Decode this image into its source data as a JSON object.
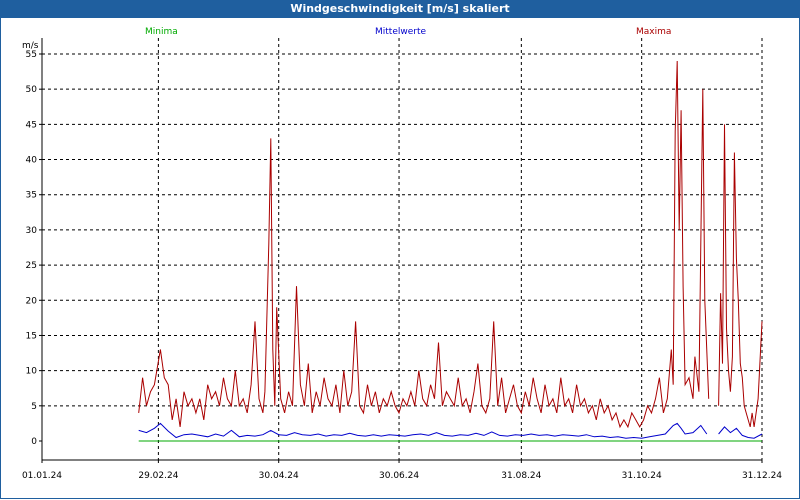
{
  "window": {
    "title": "Windgeschwindigkeit [m/s] skaliert"
  },
  "legend": {
    "minima": {
      "label": "Minima",
      "color": "#00aa00"
    },
    "mittel": {
      "label": "Mittelwerte",
      "color": "#0000cc"
    },
    "maxima": {
      "label": "Maxima",
      "color": "#aa0000"
    }
  },
  "chart_data": {
    "type": "line",
    "title": "Windgeschwindigkeit [m/s] skaliert",
    "ylabel": "m/s",
    "xlabel": "",
    "ylim": [
      0,
      55
    ],
    "yticks": [
      0,
      5,
      10,
      15,
      20,
      25,
      30,
      35,
      40,
      45,
      50,
      55
    ],
    "xlim": [
      "2024-01-01",
      "2024-12-31"
    ],
    "xticks": [
      {
        "date": "2024-01-01",
        "label": "01.01.24"
      },
      {
        "date": "2024-02-29",
        "label": "29.02.24"
      },
      {
        "date": "2024-04-30",
        "label": "30.04.24"
      },
      {
        "date": "2024-06-30",
        "label": "30.06.24"
      },
      {
        "date": "2024-08-31",
        "label": "31.08.24"
      },
      {
        "date": "2024-10-31",
        "label": "31.10.24"
      },
      {
        "date": "2024-12-31",
        "label": "31.12.24"
      }
    ],
    "grid": true,
    "legend_position": "top",
    "series": [
      {
        "name": "Maxima",
        "color": "#aa0000",
        "points": [
          [
            "2024-02-19",
            4
          ],
          [
            "2024-02-21",
            9
          ],
          [
            "2024-02-23",
            5
          ],
          [
            "2024-02-25",
            7
          ],
          [
            "2024-02-27",
            8
          ],
          [
            "2024-03-01",
            13
          ],
          [
            "2024-03-03",
            9
          ],
          [
            "2024-03-05",
            8
          ],
          [
            "2024-03-07",
            3
          ],
          [
            "2024-03-09",
            6
          ],
          [
            "2024-03-11",
            2
          ],
          [
            "2024-03-13",
            7
          ],
          [
            "2024-03-15",
            5
          ],
          [
            "2024-03-17",
            6
          ],
          [
            "2024-03-19",
            4
          ],
          [
            "2024-03-21",
            6
          ],
          [
            "2024-03-23",
            3
          ],
          [
            "2024-03-25",
            8
          ],
          [
            "2024-03-27",
            6
          ],
          [
            "2024-03-29",
            7
          ],
          [
            "2024-03-31",
            5
          ],
          [
            "2024-04-02",
            9
          ],
          [
            "2024-04-04",
            6
          ],
          [
            "2024-04-06",
            5
          ],
          [
            "2024-04-08",
            10
          ],
          [
            "2024-04-10",
            5
          ],
          [
            "2024-04-12",
            6
          ],
          [
            "2024-04-14",
            4
          ],
          [
            "2024-04-16",
            8
          ],
          [
            "2024-04-18",
            17
          ],
          [
            "2024-04-20",
            6
          ],
          [
            "2024-04-22",
            4
          ],
          [
            "2024-04-23",
            7
          ],
          [
            "2024-04-25",
            28
          ],
          [
            "2024-04-26",
            43
          ],
          [
            "2024-04-27",
            13
          ],
          [
            "2024-04-28",
            5
          ],
          [
            "2024-04-29",
            19
          ],
          [
            "2024-05-01",
            6
          ],
          [
            "2024-05-03",
            4
          ],
          [
            "2024-05-05",
            7
          ],
          [
            "2024-05-07",
            5
          ],
          [
            "2024-05-09",
            22
          ],
          [
            "2024-05-11",
            8
          ],
          [
            "2024-05-13",
            5
          ],
          [
            "2024-05-15",
            11
          ],
          [
            "2024-05-17",
            4
          ],
          [
            "2024-05-19",
            7
          ],
          [
            "2024-05-21",
            5
          ],
          [
            "2024-05-23",
            9
          ],
          [
            "2024-05-25",
            6
          ],
          [
            "2024-05-27",
            5
          ],
          [
            "2024-05-29",
            8
          ],
          [
            "2024-05-31",
            4
          ],
          [
            "2024-06-02",
            10
          ],
          [
            "2024-06-04",
            5
          ],
          [
            "2024-06-06",
            7
          ],
          [
            "2024-06-08",
            17
          ],
          [
            "2024-06-10",
            5
          ],
          [
            "2024-06-12",
            4
          ],
          [
            "2024-06-14",
            8
          ],
          [
            "2024-06-16",
            5
          ],
          [
            "2024-06-18",
            7
          ],
          [
            "2024-06-20",
            4
          ],
          [
            "2024-06-22",
            6
          ],
          [
            "2024-06-24",
            5
          ],
          [
            "2024-06-26",
            7
          ],
          [
            "2024-06-28",
            5
          ],
          [
            "2024-06-30",
            4
          ],
          [
            "2024-07-02",
            6
          ],
          [
            "2024-07-04",
            5
          ],
          [
            "2024-07-06",
            7
          ],
          [
            "2024-07-08",
            5
          ],
          [
            "2024-07-10",
            10
          ],
          [
            "2024-07-12",
            6
          ],
          [
            "2024-07-14",
            5
          ],
          [
            "2024-07-16",
            8
          ],
          [
            "2024-07-18",
            6
          ],
          [
            "2024-07-20",
            14
          ],
          [
            "2024-07-22",
            5
          ],
          [
            "2024-07-24",
            7
          ],
          [
            "2024-07-26",
            6
          ],
          [
            "2024-07-28",
            5
          ],
          [
            "2024-07-30",
            9
          ],
          [
            "2024-08-01",
            5
          ],
          [
            "2024-08-03",
            6
          ],
          [
            "2024-08-05",
            4
          ],
          [
            "2024-08-07",
            7
          ],
          [
            "2024-08-09",
            11
          ],
          [
            "2024-08-11",
            5
          ],
          [
            "2024-08-13",
            4
          ],
          [
            "2024-08-15",
            6
          ],
          [
            "2024-08-17",
            17
          ],
          [
            "2024-08-19",
            5
          ],
          [
            "2024-08-21",
            9
          ],
          [
            "2024-08-23",
            4
          ],
          [
            "2024-08-25",
            6
          ],
          [
            "2024-08-27",
            8
          ],
          [
            "2024-08-29",
            5
          ],
          [
            "2024-08-31",
            4
          ],
          [
            "2024-09-02",
            7
          ],
          [
            "2024-09-04",
            5
          ],
          [
            "2024-09-06",
            9
          ],
          [
            "2024-09-08",
            6
          ],
          [
            "2024-09-10",
            4
          ],
          [
            "2024-09-12",
            8
          ],
          [
            "2024-09-14",
            5
          ],
          [
            "2024-09-16",
            6
          ],
          [
            "2024-09-18",
            4
          ],
          [
            "2024-09-20",
            9
          ],
          [
            "2024-09-22",
            5
          ],
          [
            "2024-09-24",
            6
          ],
          [
            "2024-09-26",
            4
          ],
          [
            "2024-09-28",
            8
          ],
          [
            "2024-09-30",
            5
          ],
          [
            "2024-10-02",
            6
          ],
          [
            "2024-10-04",
            4
          ],
          [
            "2024-10-06",
            5
          ],
          [
            "2024-10-08",
            3
          ],
          [
            "2024-10-10",
            6
          ],
          [
            "2024-10-12",
            4
          ],
          [
            "2024-10-14",
            5
          ],
          [
            "2024-10-16",
            3
          ],
          [
            "2024-10-18",
            4
          ],
          [
            "2024-10-20",
            2
          ],
          [
            "2024-10-22",
            3
          ],
          [
            "2024-10-24",
            2
          ],
          [
            "2024-10-26",
            4
          ],
          [
            "2024-10-28",
            3
          ],
          [
            "2024-10-30",
            2
          ],
          [
            "2024-11-01",
            3
          ],
          [
            "2024-11-03",
            5
          ],
          [
            "2024-11-05",
            4
          ],
          [
            "2024-11-07",
            6
          ],
          [
            "2024-11-09",
            9
          ],
          [
            "2024-11-11",
            4
          ],
          [
            "2024-11-13",
            6
          ],
          [
            "2024-11-15",
            13
          ],
          [
            "2024-11-16",
            8
          ],
          [
            "2024-11-17",
            44
          ],
          [
            "2024-11-18",
            54
          ],
          [
            "2024-11-19",
            30
          ],
          [
            "2024-11-20",
            47
          ],
          [
            "2024-11-21",
            22
          ],
          [
            "2024-11-22",
            8
          ],
          [
            "2024-11-24",
            9
          ],
          [
            "2024-11-26",
            6
          ],
          [
            "2024-11-27",
            12
          ],
          [
            "2024-11-29",
            7
          ],
          [
            "2024-12-01",
            50
          ],
          [
            "2024-12-02",
            20
          ],
          [
            "2024-12-04",
            6
          ],
          [
            "2024-12-06",
            null
          ],
          [
            "2024-12-09",
            5
          ],
          [
            "2024-12-10",
            21
          ],
          [
            "2024-12-11",
            11
          ],
          [
            "2024-12-12",
            45
          ],
          [
            "2024-12-13",
            16
          ],
          [
            "2024-12-14",
            10
          ],
          [
            "2024-12-15",
            7
          ],
          [
            "2024-12-16",
            12
          ],
          [
            "2024-12-17",
            41
          ],
          [
            "2024-12-18",
            26
          ],
          [
            "2024-12-19",
            20
          ],
          [
            "2024-12-20",
            11
          ],
          [
            "2024-12-21",
            9
          ],
          [
            "2024-12-22",
            5
          ],
          [
            "2024-12-23",
            4
          ],
          [
            "2024-12-24",
            3
          ],
          [
            "2024-12-25",
            2
          ],
          [
            "2024-12-26",
            4
          ],
          [
            "2024-12-27",
            2
          ],
          [
            "2024-12-29",
            6
          ],
          [
            "2024-12-31",
            17
          ]
        ]
      },
      {
        "name": "Mittelwerte",
        "color": "#0000cc",
        "points": [
          [
            "2024-02-19",
            1.5
          ],
          [
            "2024-02-23",
            1.2
          ],
          [
            "2024-02-27",
            1.8
          ],
          [
            "2024-03-01",
            2.5
          ],
          [
            "2024-03-05",
            1.4
          ],
          [
            "2024-03-09",
            0.5
          ],
          [
            "2024-03-13",
            0.9
          ],
          [
            "2024-03-17",
            1.0
          ],
          [
            "2024-03-21",
            0.8
          ],
          [
            "2024-03-25",
            0.6
          ],
          [
            "2024-03-29",
            1.0
          ],
          [
            "2024-04-02",
            0.7
          ],
          [
            "2024-04-06",
            1.5
          ],
          [
            "2024-04-10",
            0.6
          ],
          [
            "2024-04-14",
            0.8
          ],
          [
            "2024-04-18",
            0.7
          ],
          [
            "2024-04-22",
            0.9
          ],
          [
            "2024-04-26",
            1.5
          ],
          [
            "2024-04-30",
            0.9
          ],
          [
            "2024-05-04",
            0.8
          ],
          [
            "2024-05-08",
            1.2
          ],
          [
            "2024-05-12",
            0.9
          ],
          [
            "2024-05-16",
            0.8
          ],
          [
            "2024-05-20",
            1.0
          ],
          [
            "2024-05-24",
            0.7
          ],
          [
            "2024-05-28",
            0.9
          ],
          [
            "2024-06-01",
            0.8
          ],
          [
            "2024-06-05",
            1.1
          ],
          [
            "2024-06-09",
            0.8
          ],
          [
            "2024-06-13",
            0.7
          ],
          [
            "2024-06-17",
            0.9
          ],
          [
            "2024-06-21",
            0.7
          ],
          [
            "2024-06-25",
            0.9
          ],
          [
            "2024-06-29",
            0.8
          ],
          [
            "2024-07-03",
            0.7
          ],
          [
            "2024-07-07",
            0.9
          ],
          [
            "2024-07-11",
            1.0
          ],
          [
            "2024-07-15",
            0.8
          ],
          [
            "2024-07-19",
            1.2
          ],
          [
            "2024-07-23",
            0.8
          ],
          [
            "2024-07-27",
            0.7
          ],
          [
            "2024-07-31",
            0.9
          ],
          [
            "2024-08-04",
            0.8
          ],
          [
            "2024-08-08",
            1.1
          ],
          [
            "2024-08-12",
            0.8
          ],
          [
            "2024-08-16",
            1.3
          ],
          [
            "2024-08-20",
            0.8
          ],
          [
            "2024-08-24",
            0.7
          ],
          [
            "2024-08-28",
            0.9
          ],
          [
            "2024-09-01",
            0.8
          ],
          [
            "2024-09-05",
            1.0
          ],
          [
            "2024-09-09",
            0.8
          ],
          [
            "2024-09-13",
            0.9
          ],
          [
            "2024-09-17",
            0.7
          ],
          [
            "2024-09-21",
            0.9
          ],
          [
            "2024-09-25",
            0.8
          ],
          [
            "2024-09-29",
            0.7
          ],
          [
            "2024-10-03",
            0.9
          ],
          [
            "2024-10-07",
            0.6
          ],
          [
            "2024-10-11",
            0.7
          ],
          [
            "2024-10-15",
            0.5
          ],
          [
            "2024-10-19",
            0.6
          ],
          [
            "2024-10-23",
            0.4
          ],
          [
            "2024-10-27",
            0.5
          ],
          [
            "2024-10-31",
            0.4
          ],
          [
            "2024-11-04",
            0.6
          ],
          [
            "2024-11-08",
            0.8
          ],
          [
            "2024-11-12",
            1.0
          ],
          [
            "2024-11-16",
            2.2
          ],
          [
            "2024-11-18",
            2.5
          ],
          [
            "2024-11-20",
            1.8
          ],
          [
            "2024-11-22",
            1.0
          ],
          [
            "2024-11-26",
            1.2
          ],
          [
            "2024-11-30",
            2.2
          ],
          [
            "2024-12-03",
            1.0
          ],
          [
            "2024-12-06",
            null
          ],
          [
            "2024-12-09",
            1.0
          ],
          [
            "2024-12-12",
            2.0
          ],
          [
            "2024-12-15",
            1.2
          ],
          [
            "2024-12-18",
            1.8
          ],
          [
            "2024-12-21",
            0.8
          ],
          [
            "2024-12-24",
            0.5
          ],
          [
            "2024-12-27",
            0.4
          ],
          [
            "2024-12-31",
            1.0
          ]
        ]
      },
      {
        "name": "Minima",
        "color": "#00aa00",
        "points": [
          [
            "2024-02-19",
            0
          ],
          [
            "2024-12-31",
            0
          ]
        ]
      }
    ]
  }
}
